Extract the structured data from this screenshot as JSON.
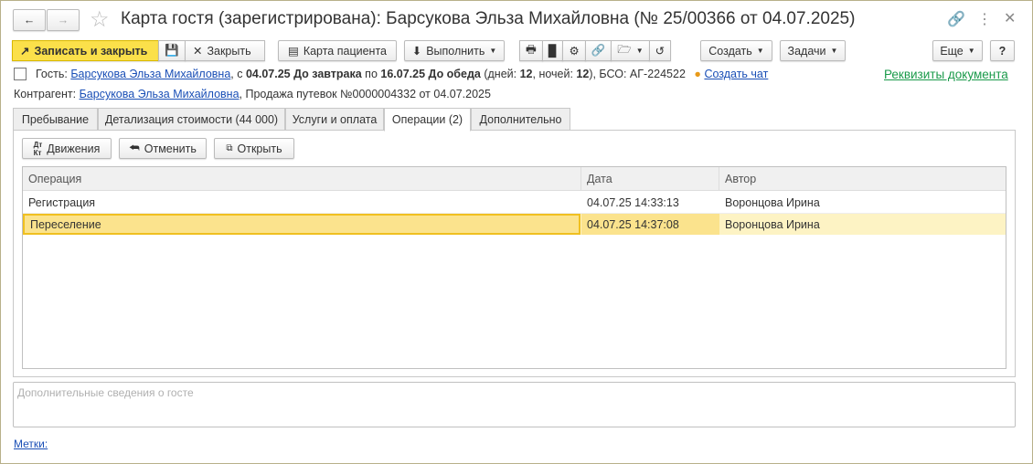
{
  "window": {
    "title": "Карта гостя (зарегистрирована): Барсукова Эльза Михайловна (№ 25/00366 от 04.07.2025)"
  },
  "toolbar": {
    "save_close": "Записать и закрыть",
    "close": "Закрыть",
    "patient_card": "Карта пациента",
    "execute": "Выполнить",
    "create": "Создать",
    "tasks": "Задачи",
    "more": "Еще",
    "help": "?"
  },
  "guest": {
    "label": "Гость:",
    "name": "Барсукова Эльза Михайловна",
    "from_prefix": ", с ",
    "from": "04.07.25 До завтрака",
    "to_prefix": " по ",
    "to": "16.07.25 До обеда",
    "days_prefix": " (дней: ",
    "days": "12",
    "nights_prefix": ", ночей: ",
    "nights": "12",
    "bso": "), БСО: АГ-224522",
    "chat": "Создать чат",
    "requisites": "Реквизиты документа"
  },
  "contractor": {
    "label": "Контрагент:",
    "name": "Барсукова Эльза Михайловна",
    "rest": ", Продажа путевок №0000004332 от 04.07.2025"
  },
  "tabs": [
    "Пребывание",
    "Детализация стоимости (44 000)",
    "Услуги и оплата",
    "Операции (2)",
    "Дополнительно"
  ],
  "ops_toolbar": {
    "movements": "Движения",
    "cancel": "Отменить",
    "open": "Открыть"
  },
  "table": {
    "headers": [
      "Операция",
      "Дата",
      "Автор"
    ],
    "rows": [
      [
        "Регистрация",
        "04.07.25 14:33:13",
        "Воронцова Ирина"
      ],
      [
        "Переселение",
        "04.07.25 14:37:08",
        "Воронцова Ирина"
      ]
    ]
  },
  "notes": {
    "placeholder": "Дополнительные сведения о госте"
  },
  "tags_link": "Метки:"
}
